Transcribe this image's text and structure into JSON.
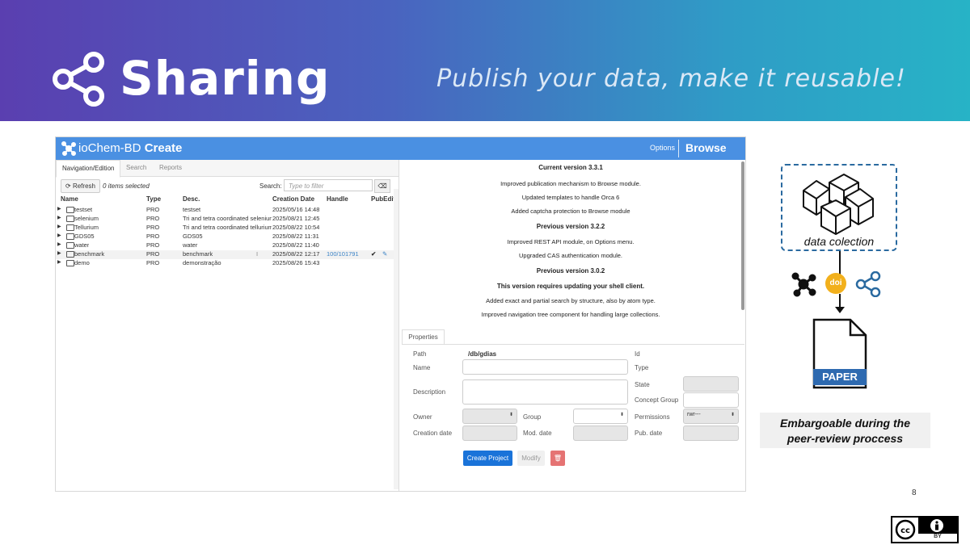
{
  "slide": {
    "title": "Sharing",
    "subtitle": "Publish your data, make it reusable!",
    "page_number": "8",
    "colors": {
      "banner_start": "#5a3fb0",
      "banner_end": "#27b3c6",
      "app_bar": "#4a90e2",
      "primary_button": "#1a73d9",
      "delete_button": "#e57373"
    }
  },
  "app": {
    "title_prefix": "ioChem-BD",
    "title_bold": "Create",
    "options_label": "Options",
    "browse_label": "Browse",
    "tabs": [
      "Navigation/Edition",
      "Search",
      "Reports"
    ],
    "toolbar": {
      "refresh_label": "Refresh",
      "selected_text": "0 items selected",
      "search_label": "Search:",
      "search_placeholder": "Type to filter"
    },
    "columns": [
      "Name",
      "Type",
      "Desc.",
      "Creation Date",
      "Handle",
      "PubEdit"
    ],
    "rows": [
      {
        "name": "testset",
        "type": "PRO",
        "desc": "testset",
        "date": "2025/05/16 14:48",
        "handle": ""
      },
      {
        "name": "selenium",
        "type": "PRO",
        "desc": "Tri and tetra coordinated selenium",
        "date": "2025/08/21 12:45",
        "handle": ""
      },
      {
        "name": "Tellurium",
        "type": "PRO",
        "desc": "Tri and tetra coordinated tellurium",
        "date": "2025/08/22 10:54",
        "handle": ""
      },
      {
        "name": "GDS05",
        "type": "PRO",
        "desc": "GDS05",
        "date": "2025/08/22 11:31",
        "handle": ""
      },
      {
        "name": "water",
        "type": "PRO",
        "desc": "water",
        "date": "2025/08/22 11:40",
        "handle": ""
      },
      {
        "name": "benchmark",
        "type": "PRO",
        "desc": "benchmark",
        "date": "2025/08/22 12:17",
        "handle": "100/101791"
      },
      {
        "name": "demo",
        "type": "PRO",
        "desc": "demonstração",
        "date": "2025/08/26 15:43",
        "handle": ""
      }
    ],
    "release_notes": {
      "current_heading": "Current version 3.3.1",
      "current_items": [
        "Improved publication mechanism to Browse module.",
        "Updated templates to handle Orca 6",
        "Added captcha protection to Browse module"
      ],
      "previous1_heading": "Previous version 3.2.2",
      "previous1_items": [
        "Improved REST API module, on Options menu.",
        "Upgraded CAS authentication module."
      ],
      "previous2_heading": "Previous version 3.0.2",
      "previous2_bold": "This version requires updating your shell client.",
      "previous2_items": [
        "Added exact and partial search by structure, also by atom type.",
        "Improved navigation tree component for handling large collections."
      ]
    },
    "properties": {
      "tab_label": "Properties",
      "path_label": "Path",
      "path_value": "/db/gdias",
      "id_label": "Id",
      "name_label": "Name",
      "type_label": "Type",
      "state_label": "State",
      "description_label": "Description",
      "concept_group_label": "Concept Group",
      "owner_label": "Owner",
      "group_label": "Group",
      "permissions_label": "Permissions",
      "permissions_value": "rwr---",
      "creation_date_label": "Creation date",
      "mod_date_label": "Mod. date",
      "pub_date_label": "Pub. date",
      "create_button": "Create Project",
      "modify_button": "Modify"
    }
  },
  "workflow": {
    "data_collection_label": "data colection",
    "doi_label": "doi",
    "paper_label": "PAPER",
    "embargo_line1": "Embargoable during the",
    "embargo_line2": "peer-review proccess"
  },
  "license": {
    "badge_text": "BY",
    "icons": [
      "cc-icon",
      "attribution-icon"
    ]
  }
}
